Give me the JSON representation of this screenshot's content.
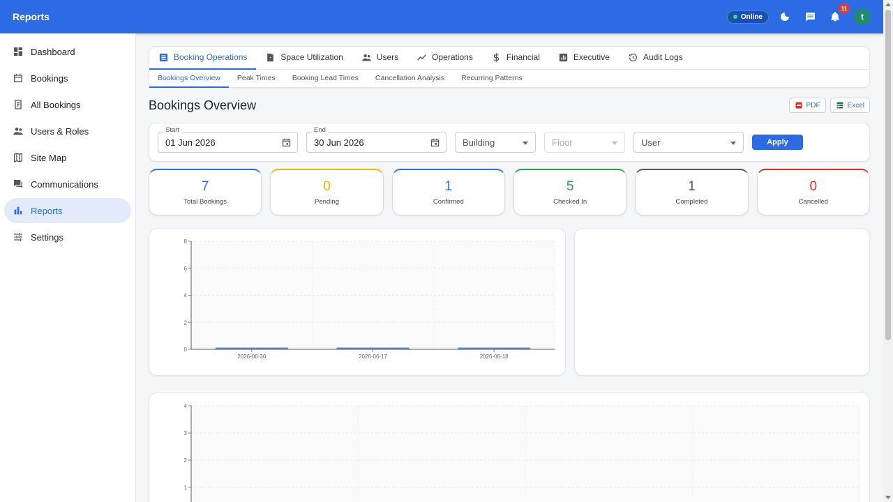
{
  "app": {
    "title": "Reports",
    "status": "Online",
    "notifications_count": "11",
    "avatar_initial": "t"
  },
  "sidebar": {
    "items": [
      {
        "label": "Dashboard",
        "icon": "dashboard-icon"
      },
      {
        "label": "Bookings",
        "icon": "calendar-icon"
      },
      {
        "label": "All Bookings",
        "icon": "book-icon"
      },
      {
        "label": "Users & Roles",
        "icon": "people-icon"
      },
      {
        "label": "Site Map",
        "icon": "map-icon"
      },
      {
        "label": "Communications",
        "icon": "forum-icon"
      },
      {
        "label": "Reports",
        "icon": "bar-chart-icon",
        "active": true
      },
      {
        "label": "Settings",
        "icon": "sliders-icon"
      }
    ]
  },
  "tabs": [
    {
      "label": "Booking Operations",
      "icon": "list-icon",
      "active": true
    },
    {
      "label": "Space Utilization",
      "icon": "door-icon"
    },
    {
      "label": "Users",
      "icon": "people-icon"
    },
    {
      "label": "Operations",
      "icon": "trending-icon"
    },
    {
      "label": "Financial",
      "icon": "dollar-icon"
    },
    {
      "label": "Executive",
      "icon": "chart-box-icon"
    },
    {
      "label": "Audit Logs",
      "icon": "history-icon"
    }
  ],
  "subtabs": [
    {
      "label": "Bookings Overview",
      "active": true
    },
    {
      "label": "Peak Times"
    },
    {
      "label": "Booking Lead Times"
    },
    {
      "label": "Cancellation Analysis"
    },
    {
      "label": "Recurring Patterns"
    }
  ],
  "page": {
    "title": "Bookings Overview",
    "export_pdf": "PDF",
    "export_excel": "Excel"
  },
  "filters": {
    "start_label": "Start",
    "start_value": "01 Jun 2026",
    "end_label": "End",
    "end_value": "30 Jun 2026",
    "building": "Building",
    "floor": "Floor",
    "user": "User",
    "apply": "Apply"
  },
  "stats": [
    {
      "value": "7",
      "label": "Total Bookings",
      "color": "#2d6be4"
    },
    {
      "value": "0",
      "label": "Pending",
      "color": "#f4b400"
    },
    {
      "value": "1",
      "label": "Confirmed",
      "color": "#2d6be4"
    },
    {
      "value": "5",
      "label": "Checked In",
      "color": "#2e9b4f"
    },
    {
      "value": "1",
      "label": "Completed",
      "color": "#555555"
    },
    {
      "value": "0",
      "label": "Cancelled",
      "color": "#d93025"
    }
  ],
  "colors": {
    "primary": "#2d6be4",
    "bar": "#5b8bd9"
  },
  "chart_data": [
    {
      "type": "bar",
      "categories": [
        "2026-06-30",
        "2026-06-17",
        "2026-06-18"
      ],
      "values": [
        0,
        0,
        0
      ],
      "ylim": [
        0,
        8
      ],
      "yticks": [
        "0",
        "2",
        "4",
        "6",
        "8"
      ],
      "grid": true
    },
    {
      "type": "line",
      "ylim": [
        0,
        4
      ],
      "yticks": [
        "1",
        "2",
        "3",
        "4"
      ],
      "grid": true
    }
  ]
}
